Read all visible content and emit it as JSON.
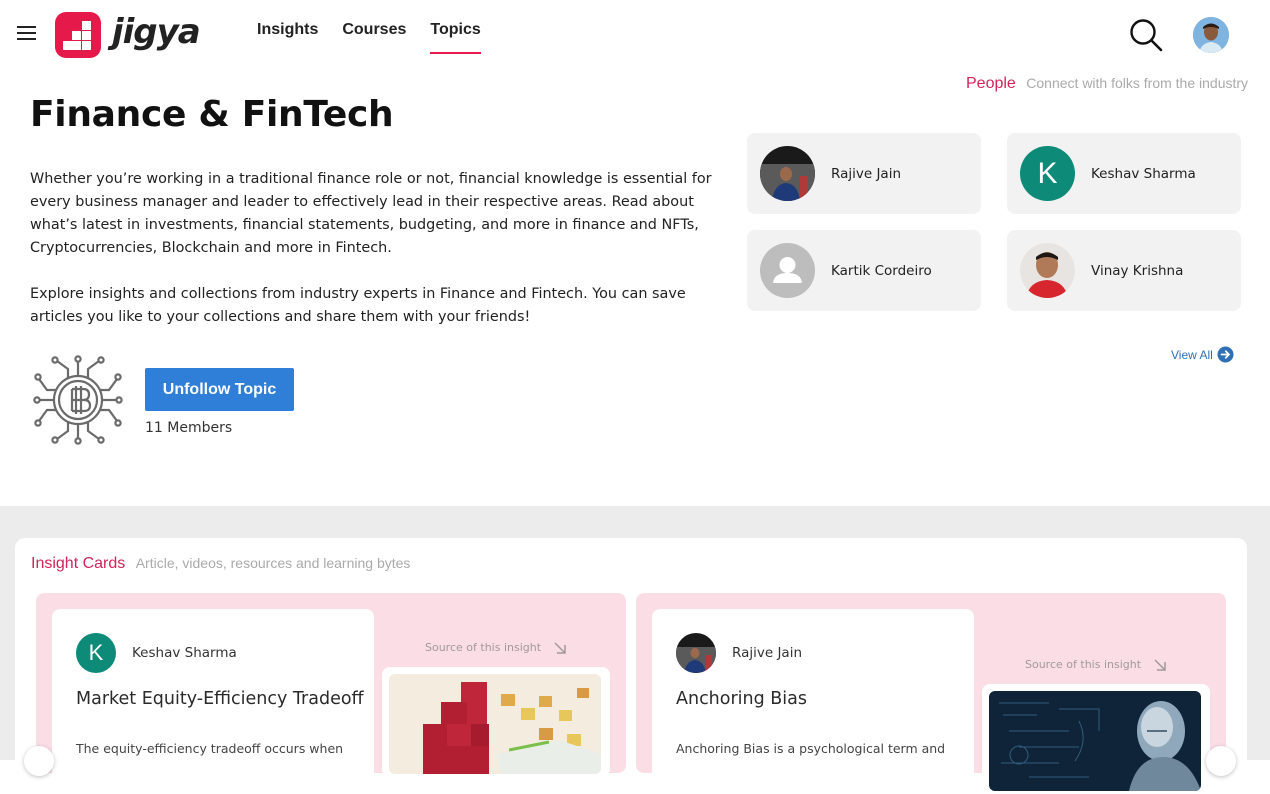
{
  "header": {
    "logo_text": "jigya",
    "nav": [
      {
        "label": "Insights"
      },
      {
        "label": "Courses"
      },
      {
        "label": "Topics"
      }
    ],
    "active_nav": "Topics",
    "accent_color": "#e6194b"
  },
  "topic": {
    "title": "Finance & FinTech",
    "description_1": "Whether you’re working in a traditional finance role or not, financial knowledge is essential for every business manager and leader to effectively lead in their respective areas. Read about what’s latest in investments, financial statements, budgeting, and more in finance and NFTs, Cryptocurrencies, Blockchain and more in Fintech.",
    "description_2": "Explore insights and collections from industry experts in Finance and Fintech. You can save articles you like to your collections and share them with your friends!",
    "icon": "bitcoin-circuit-icon",
    "unfollow_label": "Unfollow Topic",
    "members": "11 Members",
    "button_color": "#2f7fd8"
  },
  "people": {
    "title": "People",
    "subtitle": "Connect with folks from the industry",
    "items": [
      {
        "name": "Rajive Jain",
        "avatar": "photo"
      },
      {
        "name": "Keshav Sharma",
        "avatar": "initial",
        "initial": "K"
      },
      {
        "name": "Kartik Cordeiro",
        "avatar": "placeholder"
      },
      {
        "name": "Vinay Krishna",
        "avatar": "photo"
      }
    ],
    "view_all": "View All"
  },
  "insights": {
    "title": "Insight Cards",
    "subtitle": "Article, videos, resources and learning bytes",
    "source_label": "Source of this insight",
    "cards": [
      {
        "author": "Keshav Sharma",
        "author_initial": "K",
        "title": "Market Equity-Efficiency Tradeoff",
        "snippet": "The equity-efficiency tradeoff occurs when"
      },
      {
        "author": "Rajive Jain",
        "title": "Anchoring Bias",
        "snippet": "Anchoring Bias is a psychological term and"
      }
    ]
  }
}
